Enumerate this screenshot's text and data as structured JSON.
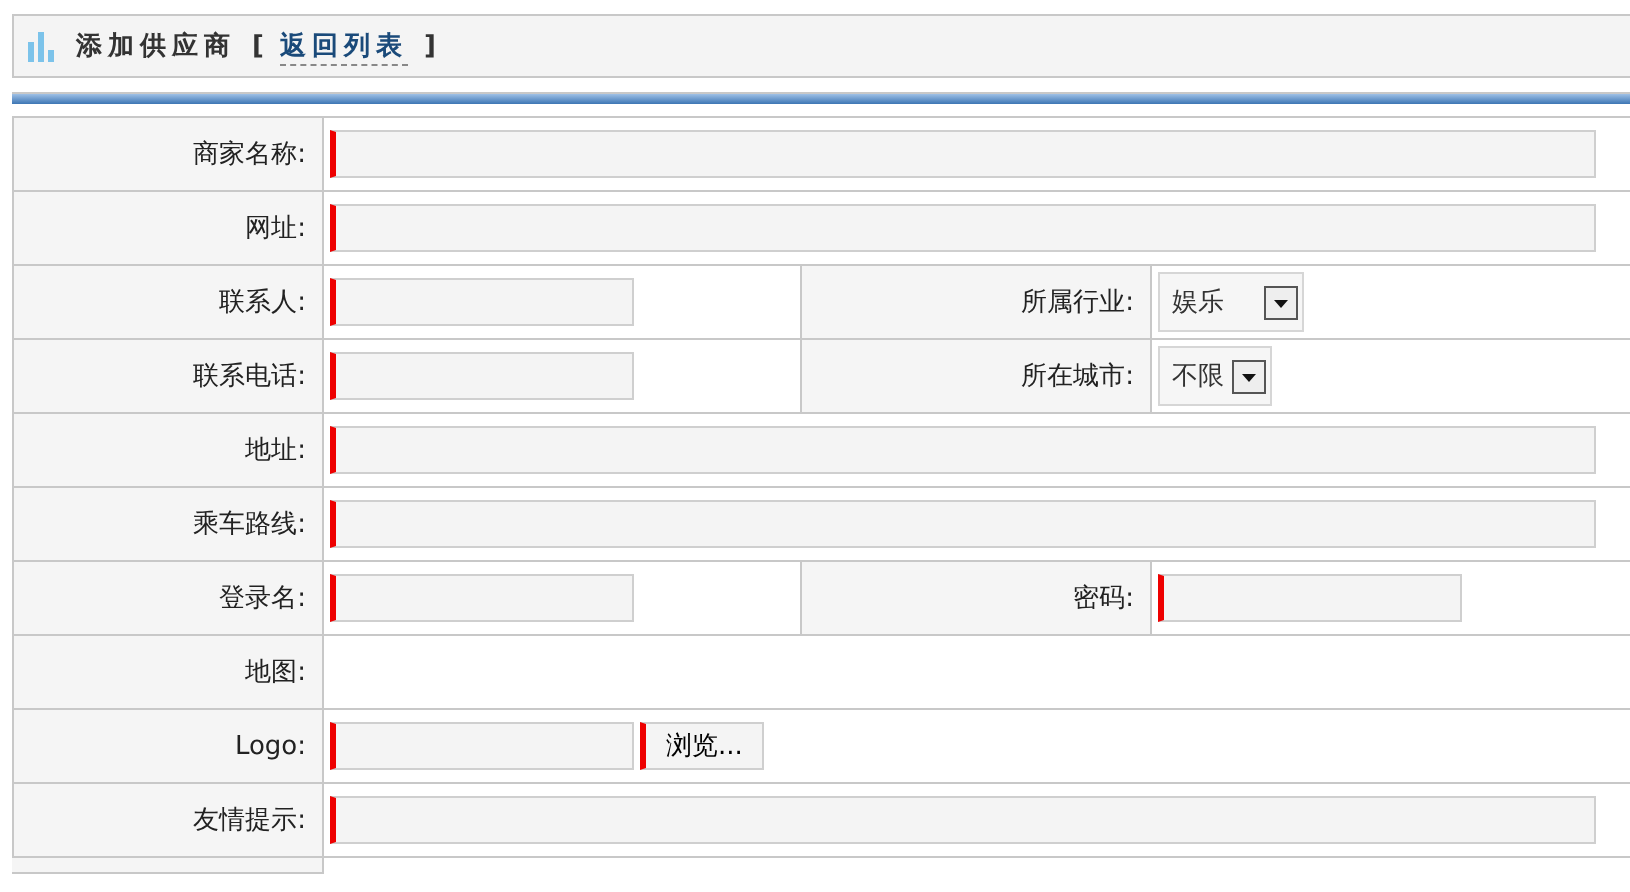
{
  "header": {
    "title": "添加供应商",
    "bracket_open": "[",
    "back_link": "返回列表",
    "bracket_close": "]"
  },
  "rows": [
    {
      "kind": "full",
      "label": "商家名称:",
      "field": {
        "kind": "text",
        "required": true
      }
    },
    {
      "kind": "full",
      "label": "网址:",
      "field": {
        "kind": "text",
        "required": true
      }
    },
    {
      "kind": "pair",
      "label": "联系人:",
      "field": {
        "kind": "short",
        "required": true
      },
      "label2": "所属行业:",
      "field2": {
        "kind": "select",
        "value": "娱乐"
      }
    },
    {
      "kind": "pair",
      "label": "联系电话:",
      "field": {
        "kind": "short",
        "required": true
      },
      "label2": "所在城市:",
      "field2": {
        "kind": "select",
        "value": "不限"
      }
    },
    {
      "kind": "full",
      "label": "地址:",
      "field": {
        "kind": "text",
        "required": true
      }
    },
    {
      "kind": "full",
      "label": "乘车路线:",
      "field": {
        "kind": "text",
        "required": true
      }
    },
    {
      "kind": "pair",
      "label": "登录名:",
      "field": {
        "kind": "short",
        "required": true
      },
      "label2": "密码:",
      "field2": {
        "kind": "short",
        "required": true
      }
    },
    {
      "kind": "full",
      "label": "地图:"
    },
    {
      "kind": "full",
      "label": "Logo:",
      "field": {
        "kind": "file",
        "required": true,
        "button": "浏览..."
      }
    },
    {
      "kind": "full",
      "label": "友情提示:",
      "field": {
        "kind": "text",
        "required": true
      }
    }
  ]
}
